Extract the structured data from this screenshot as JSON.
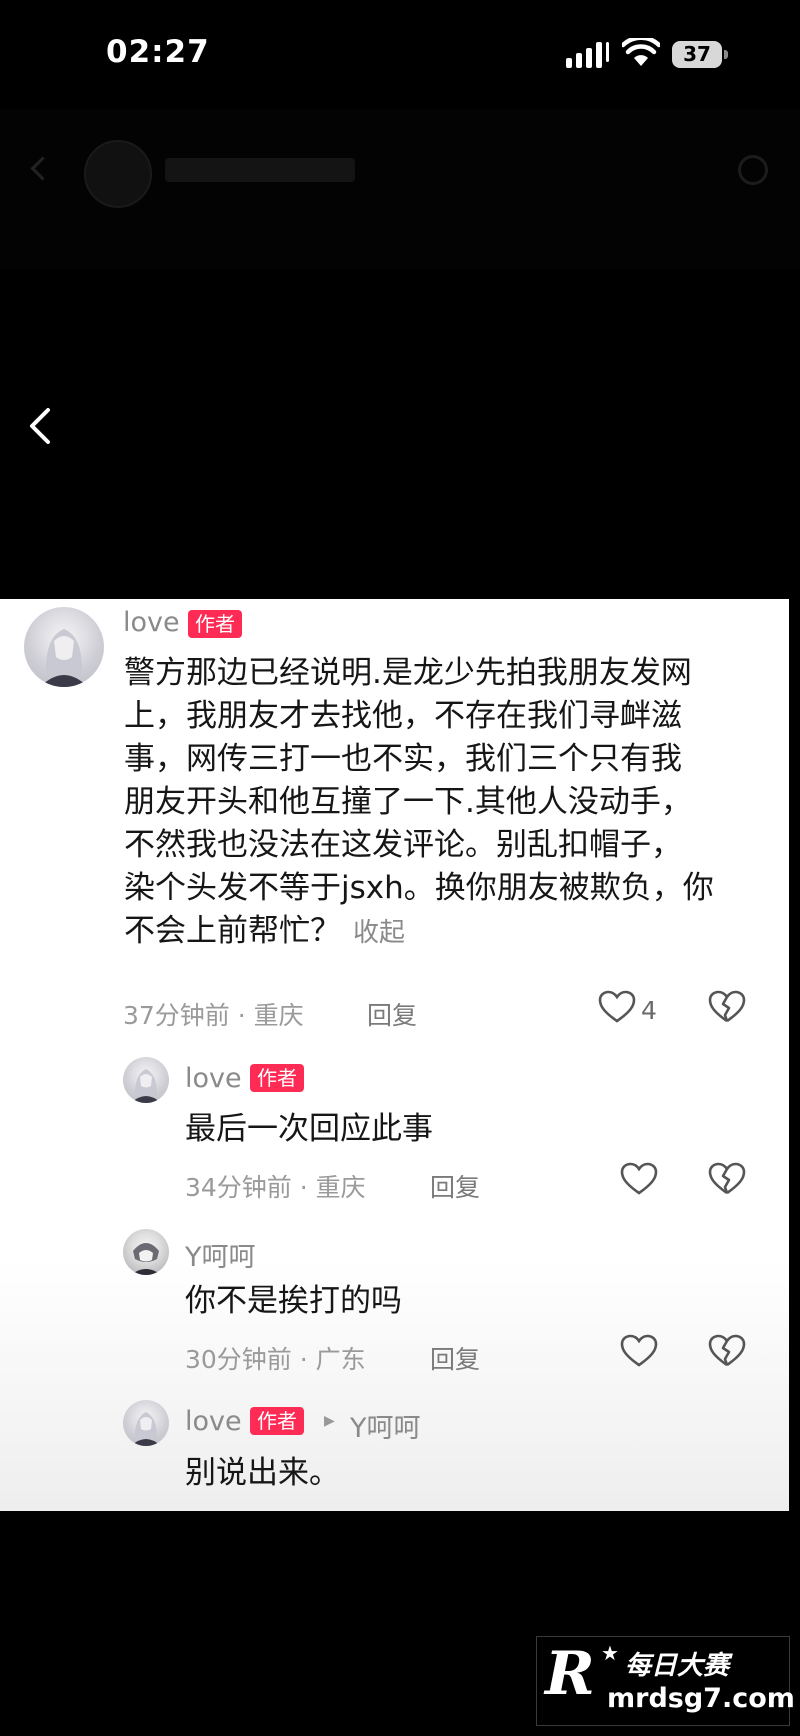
{
  "status_bar": {
    "time": "02:27",
    "battery": "37"
  },
  "comments": [
    {
      "user": "love",
      "tag": "作者",
      "lines": [
        "警方那边已经说明.是龙少先拍我朋友发网",
        "上，我朋友才去找他，不存在我们寻衅滋",
        "事，网传三打一也不实，我们三个只有我",
        "朋友开头和他互撞了一下.其他人没动手，",
        "不然我也没法在这发评论。别乱扣帽子，",
        "染个头发不等于jsxh。换你朋友被欺负，你",
        "不会上前帮忙？"
      ],
      "collapse_label": "收起",
      "meta": "37分钟前 · 重庆",
      "reply_label": "回复",
      "likes": "4"
    }
  ],
  "replies": [
    {
      "user": "love",
      "tag": "作者",
      "text": "最后一次回应此事",
      "meta": "34分钟前 · 重庆",
      "reply_label": "回复"
    },
    {
      "user": "Y呵呵",
      "text": "你不是挨打的吗",
      "meta": "30分钟前 · 广东",
      "reply_label": "回复"
    },
    {
      "user": "love",
      "tag": "作者",
      "reply_to": "Y呵呵",
      "text": "别说出来。"
    }
  ],
  "watermark": {
    "brand": "每日大赛",
    "url": "mrdsg7.com"
  }
}
